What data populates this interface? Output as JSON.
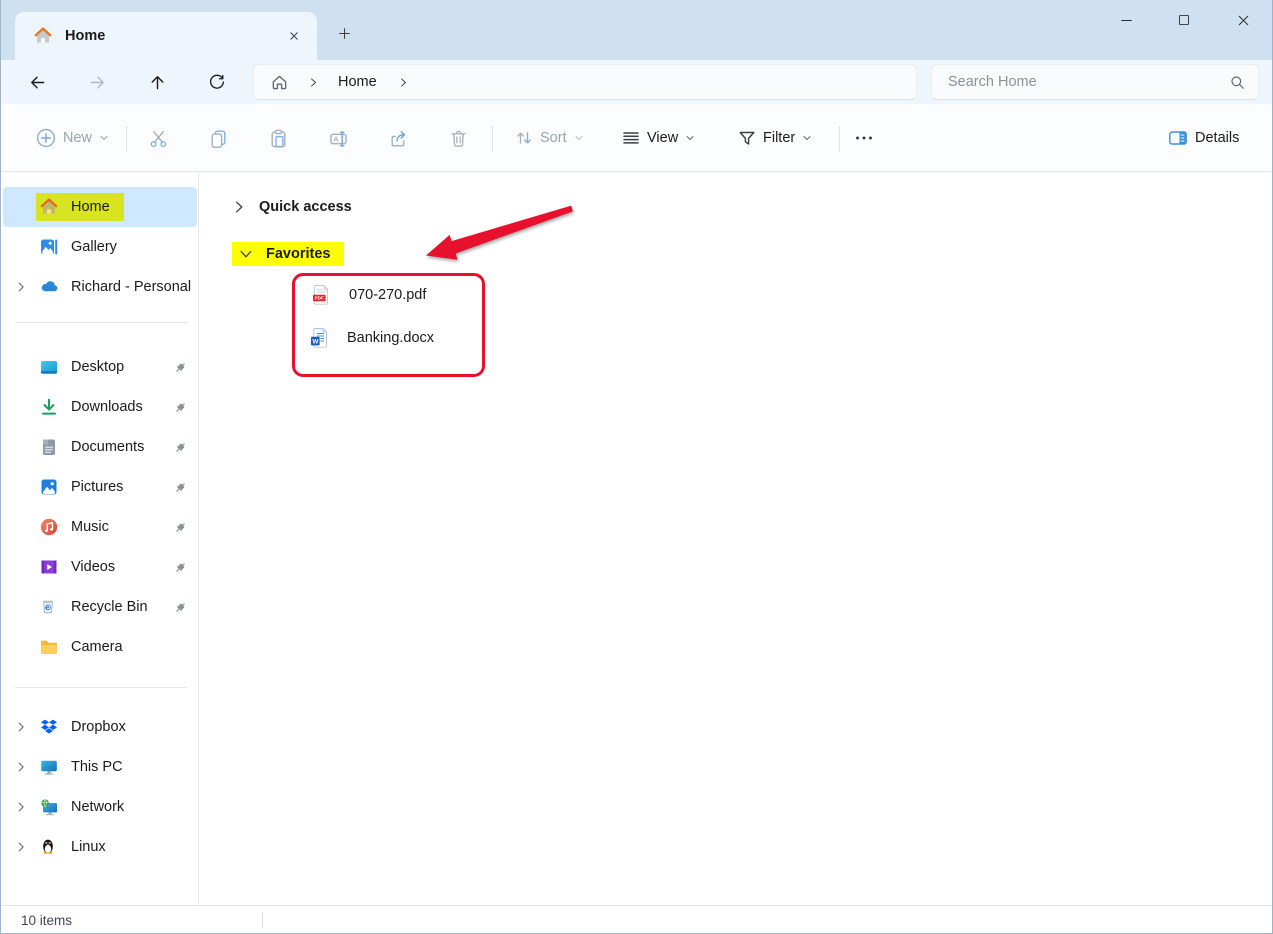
{
  "tabbar": {
    "tab_title": "Home"
  },
  "navbar": {
    "breadcrumb": {
      "root_label": "Home"
    },
    "search_placeholder": "Search Home"
  },
  "toolbar": {
    "new_label": "New",
    "sort_label": "Sort",
    "view_label": "View",
    "filter_label": "Filter",
    "details_label": "Details"
  },
  "sidebar": {
    "items": [
      {
        "label": "Home",
        "icon": "home",
        "selected": true,
        "highlighted": true
      },
      {
        "label": "Gallery",
        "icon": "gallery"
      },
      {
        "label": "Richard - Personal",
        "icon": "onedrive",
        "expandable": true
      },
      {
        "label": "Desktop",
        "icon": "desktop",
        "pinned": true
      },
      {
        "label": "Downloads",
        "icon": "downloads",
        "pinned": true
      },
      {
        "label": "Documents",
        "icon": "documents",
        "pinned": true
      },
      {
        "label": "Pictures",
        "icon": "pictures",
        "pinned": true
      },
      {
        "label": "Music",
        "icon": "music",
        "pinned": true
      },
      {
        "label": "Videos",
        "icon": "videos",
        "pinned": true
      },
      {
        "label": "Recycle Bin",
        "icon": "recycle-bin",
        "pinned": true
      },
      {
        "label": "Camera",
        "icon": "folder"
      },
      {
        "label": "Dropbox",
        "icon": "dropbox",
        "expandable": true
      },
      {
        "label": "This PC",
        "icon": "this-pc",
        "expandable": true
      },
      {
        "label": "Network",
        "icon": "network",
        "expandable": true
      },
      {
        "label": "Linux",
        "icon": "linux",
        "expandable": true
      }
    ]
  },
  "main": {
    "groups": [
      {
        "label": "Quick access",
        "expanded": false,
        "highlighted": false
      },
      {
        "label": "Favorites",
        "expanded": true,
        "highlighted": true
      }
    ],
    "files": [
      {
        "name": "070-270.pdf",
        "type": "pdf"
      },
      {
        "name": "Banking.docx",
        "type": "word"
      }
    ]
  },
  "statusbar": {
    "item_count": "10 items"
  },
  "colors": {
    "titlebar_bg": "#cfe1f1",
    "surface_bg": "#eef5fc",
    "selection_blue": "#cde8ff",
    "highlight_yellow": "#ffff00",
    "highlight_yellow_blend": "#d8e322",
    "annotation_red": "#e8112d",
    "accent_blue": "#0078d4"
  }
}
